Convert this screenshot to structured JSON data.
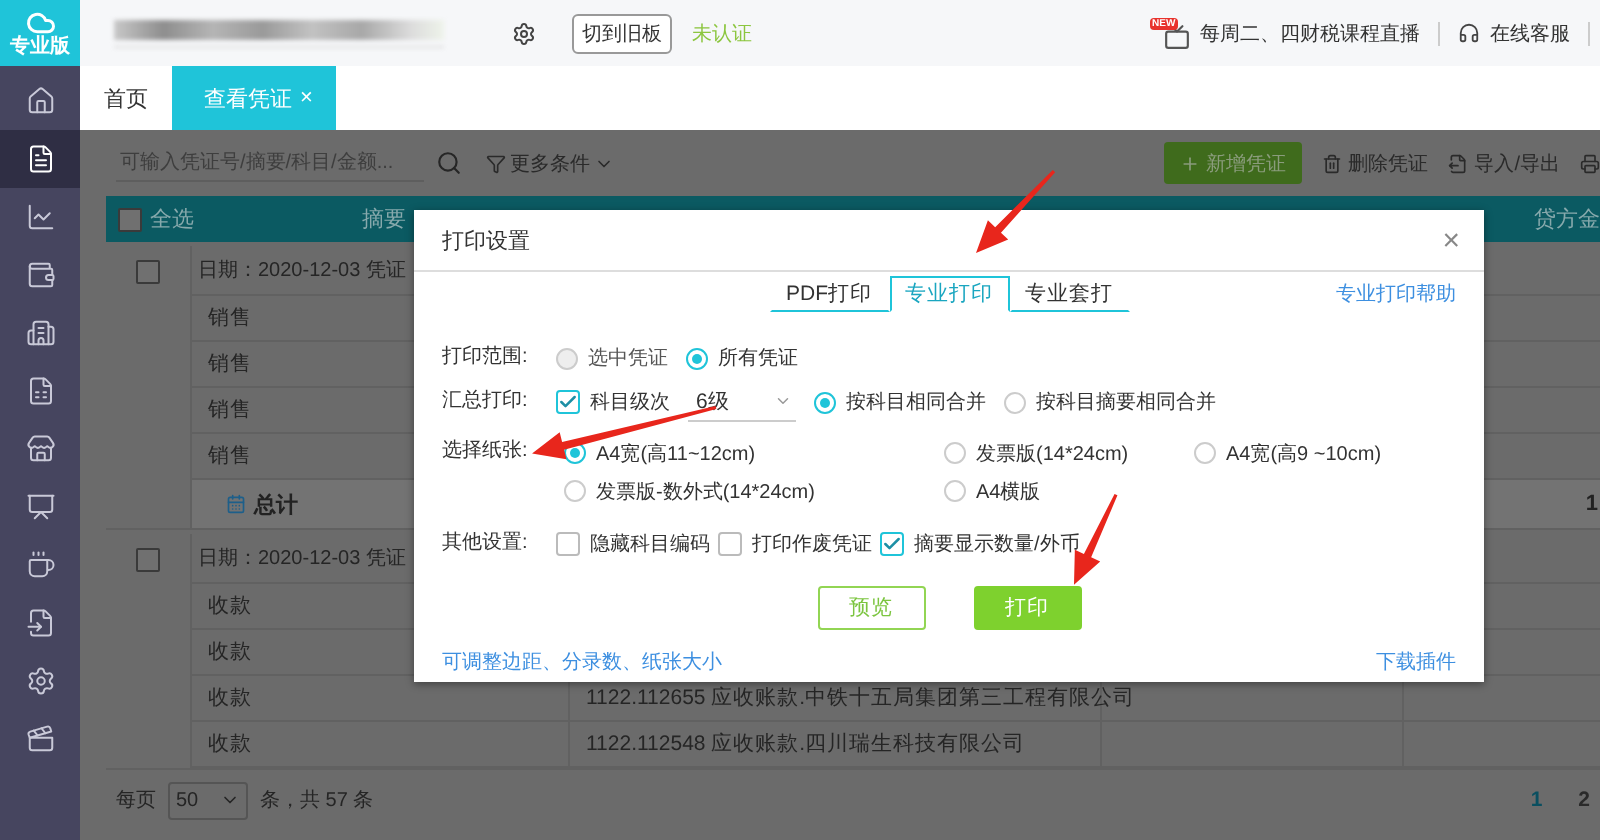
{
  "sidebar": {
    "logo": "专业版",
    "items": [
      {
        "kind": "home",
        "selected": false
      },
      {
        "kind": "voucher",
        "selected": true
      },
      {
        "kind": "chart",
        "selected": false
      },
      {
        "kind": "wallet",
        "selected": false
      },
      {
        "kind": "building",
        "selected": false
      },
      {
        "kind": "sheet",
        "selected": false
      },
      {
        "kind": "store",
        "selected": false
      },
      {
        "kind": "board",
        "selected": false
      },
      {
        "kind": "cup",
        "selected": false
      },
      {
        "kind": "import",
        "selected": false
      },
      {
        "kind": "settings",
        "selected": false
      },
      {
        "kind": "video",
        "selected": false
      }
    ]
  },
  "top_bar": {
    "switch_button": "切到旧板",
    "auth_status": "未认证",
    "live_badge": "NEW",
    "live_text": "每周二、四财税课程直播",
    "service": "在线客服"
  },
  "tabs": [
    {
      "label": "首页",
      "selected": false
    },
    {
      "label": "查看凭证",
      "selected": true,
      "close": "×"
    }
  ],
  "toolbar": {
    "search_placeholder": "可输入凭证号/摘要/科目/金额...",
    "more_filters": "更多条件",
    "buttons": [
      {
        "kind": "add",
        "label": "新增凭证"
      },
      {
        "kind": "delete",
        "label": "删除凭证"
      },
      {
        "kind": "import",
        "label": "导入/导出"
      },
      {
        "kind": "print"
      }
    ]
  },
  "table": {
    "select_all": "全选",
    "select_all_checked": false,
    "columns": [
      "摘要",
      "贷方金"
    ],
    "groups": [
      {
        "checked": false,
        "date": "日期：2020-12-03",
        "voucher": "凭证",
        "rows": [
          {
            "summary": "销售"
          },
          {
            "summary": "销售"
          },
          {
            "summary": "销售"
          },
          {
            "summary": "销售"
          }
        ],
        "total": {
          "label": "总计",
          "value": "1"
        }
      },
      {
        "checked": false,
        "date": "日期：2020-12-03",
        "voucher": "凭证",
        "rows": [
          {
            "summary": "收款"
          },
          {
            "summary": "收款"
          },
          {
            "summary": "收款",
            "account": "1122.112655  应收账款.中铁十五局集团第三工程有限公司"
          },
          {
            "summary": "收款",
            "account": "1122.112548  应收账款.四川瑞生科技有限公司"
          }
        ]
      }
    ]
  },
  "pagination": {
    "per_page_label": "每页",
    "per_page": "50",
    "total": "条，共 57 条",
    "pages": [
      {
        "label": "1",
        "selected": true
      },
      {
        "label": "2",
        "selected": false
      }
    ]
  },
  "dialog": {
    "title": "打印设置",
    "close": "×",
    "tabs": [
      {
        "label": "PDF打印",
        "selected": false
      },
      {
        "label": "专业打印",
        "selected": true
      },
      {
        "label": "专业套打",
        "selected": false
      }
    ],
    "help_link": "专业打印帮助",
    "rows": [
      {
        "kind": "radios",
        "label": "打印范围:",
        "options": [
          {
            "label": "选中凭证",
            "selected": false,
            "disabled": true
          },
          {
            "label": "所有凭证",
            "selected": true,
            "disabled": false
          }
        ]
      },
      {
        "kind": "summary",
        "label": "汇总打印:",
        "checkbox": {
          "label": "科目级次",
          "checked": true
        },
        "select": "6级",
        "options": [
          {
            "label": "按科目相同合并",
            "selected": true,
            "disabled": false
          },
          {
            "label": "按科目摘要相同合并",
            "selected": false,
            "disabled": false
          }
        ]
      },
      {
        "kind": "paper",
        "label": "选择纸张:",
        "options": [
          {
            "label": "A4宽(高11~12cm)",
            "selected": true,
            "disabled": false
          },
          {
            "label": "发票版(14*24cm)",
            "selected": false,
            "disabled": false
          },
          {
            "label": "A4宽(高9 ~10cm)",
            "selected": false,
            "disabled": false
          },
          {
            "label": "发票版-数外式(14*24cm)",
            "selected": false,
            "disabled": false
          },
          {
            "label": "A4横版",
            "selected": false,
            "disabled": false
          }
        ]
      },
      {
        "kind": "checks",
        "label": "其他设置:",
        "options": [
          {
            "label": "隐藏科目编码",
            "checked": false
          },
          {
            "label": "打印作废凭证",
            "checked": false
          },
          {
            "label": "摘要显示数量/外币",
            "checked": true
          }
        ]
      }
    ],
    "buttons": [
      {
        "kind": "outline",
        "label": "预览"
      },
      {
        "kind": "primary",
        "label": "打印"
      }
    ],
    "footer_link": "可调整边距、分录数、纸张大小",
    "download_link": "下载插件"
  }
}
